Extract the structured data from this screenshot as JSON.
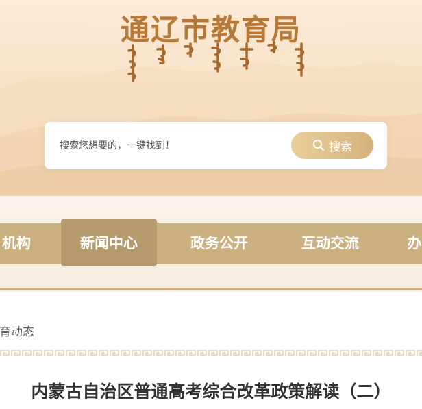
{
  "header": {
    "site_title": "通辽市教育局",
    "logo_icon": "mongolian-script-logo"
  },
  "search": {
    "placeholder": "搜索您想要的，一键找到！",
    "button_label": "搜索",
    "button_icon": "search-icon"
  },
  "nav": {
    "items": [
      {
        "label": "机构"
      },
      {
        "label": "新闻中心",
        "active": true
      },
      {
        "label": "政务公开"
      },
      {
        "label": "互动交流"
      },
      {
        "label": "办"
      }
    ]
  },
  "breadcrumb": {
    "text": "教育动态"
  },
  "article": {
    "title": "内蒙古自治区普通高考综合改革政策解读（二）"
  },
  "colors": {
    "accent": "#cbb080",
    "active_tab": "#b59a6c",
    "title_gold": "#b57a3a"
  }
}
